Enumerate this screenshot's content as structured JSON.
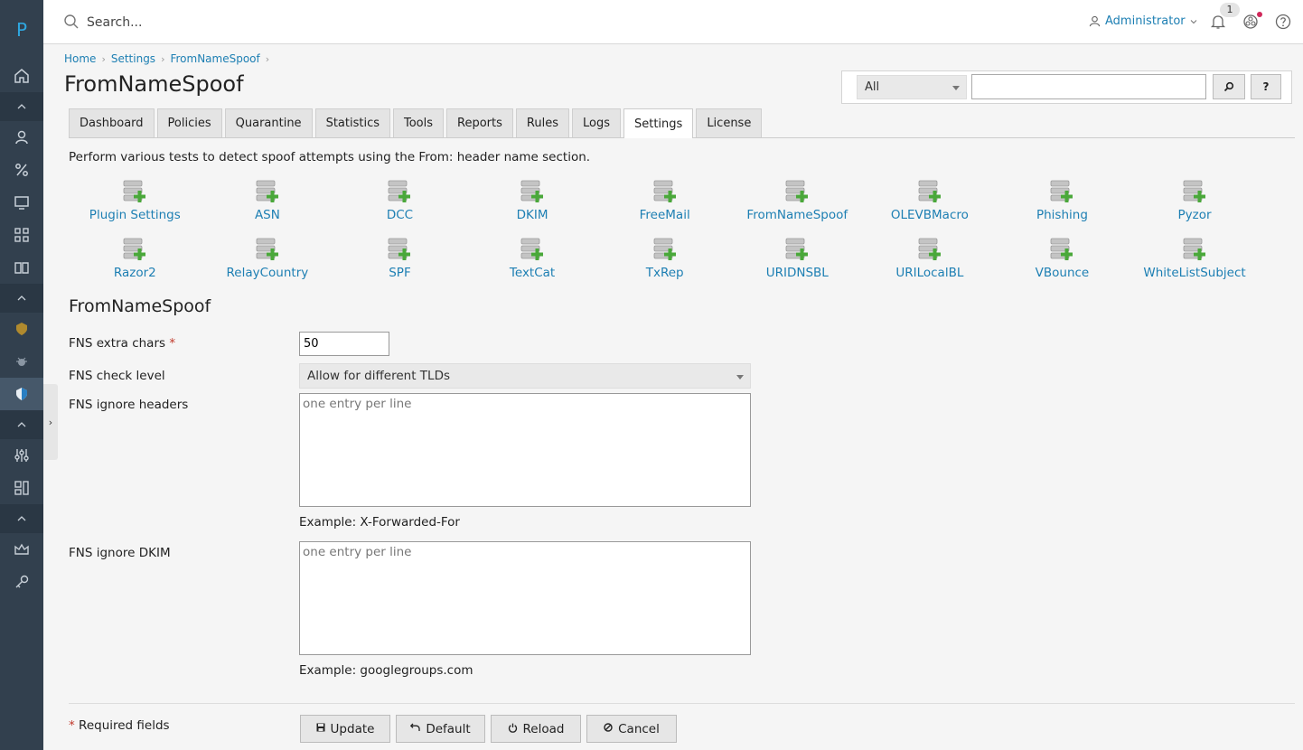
{
  "app": {
    "logo_letter": "P"
  },
  "topbar": {
    "search_placeholder": "Search...",
    "user_name": "Administrator",
    "notification_count": "1"
  },
  "breadcrumb": [
    "Home",
    "Settings",
    "FromNameSpoof"
  ],
  "page_title": "FromNameSpoof",
  "filter": {
    "selected": "All",
    "value": "",
    "help_label": "?"
  },
  "tabs": [
    {
      "label": "Dashboard",
      "active": false
    },
    {
      "label": "Policies",
      "active": false
    },
    {
      "label": "Quarantine",
      "active": false
    },
    {
      "label": "Statistics",
      "active": false
    },
    {
      "label": "Tools",
      "active": false
    },
    {
      "label": "Reports",
      "active": false
    },
    {
      "label": "Rules",
      "active": false
    },
    {
      "label": "Logs",
      "active": false
    },
    {
      "label": "Settings",
      "active": true
    },
    {
      "label": "License",
      "active": false
    }
  ],
  "intro": "Perform various tests to detect spoof attempts using the From: header name section.",
  "plugins": [
    "Plugin Settings",
    "ASN",
    "DCC",
    "DKIM",
    "FreeMail",
    "FromNameSpoof",
    "OLEVBMacro",
    "Phishing",
    "Pyzor",
    "Razor2",
    "RelayCountry",
    "SPF",
    "TextCat",
    "TxRep",
    "URIDNSBL",
    "URILocalBL",
    "VBounce",
    "WhiteListSubject"
  ],
  "form": {
    "section_title": "FromNameSpoof",
    "extra_chars": {
      "label": "FNS extra chars",
      "required_mark": "*",
      "value": "50"
    },
    "check_level": {
      "label": "FNS check level",
      "selected": "Allow for different TLDs"
    },
    "ignore_headers": {
      "label": "FNS ignore headers",
      "placeholder": "one entry per line",
      "example": "Example: X-Forwarded-For"
    },
    "ignore_dkim": {
      "label": "FNS ignore DKIM",
      "placeholder": "one entry per line",
      "example": "Example: googlegroups.com"
    }
  },
  "footer": {
    "required_mark": "*",
    "required_note": "Required fields",
    "buttons": {
      "update": "Update",
      "default": "Default",
      "reload": "Reload",
      "cancel": "Cancel"
    }
  },
  "colors": {
    "sidebar": "#32404e",
    "link": "#1d7fb3",
    "accent": "#2ea7e0",
    "required": "#c0392b"
  }
}
